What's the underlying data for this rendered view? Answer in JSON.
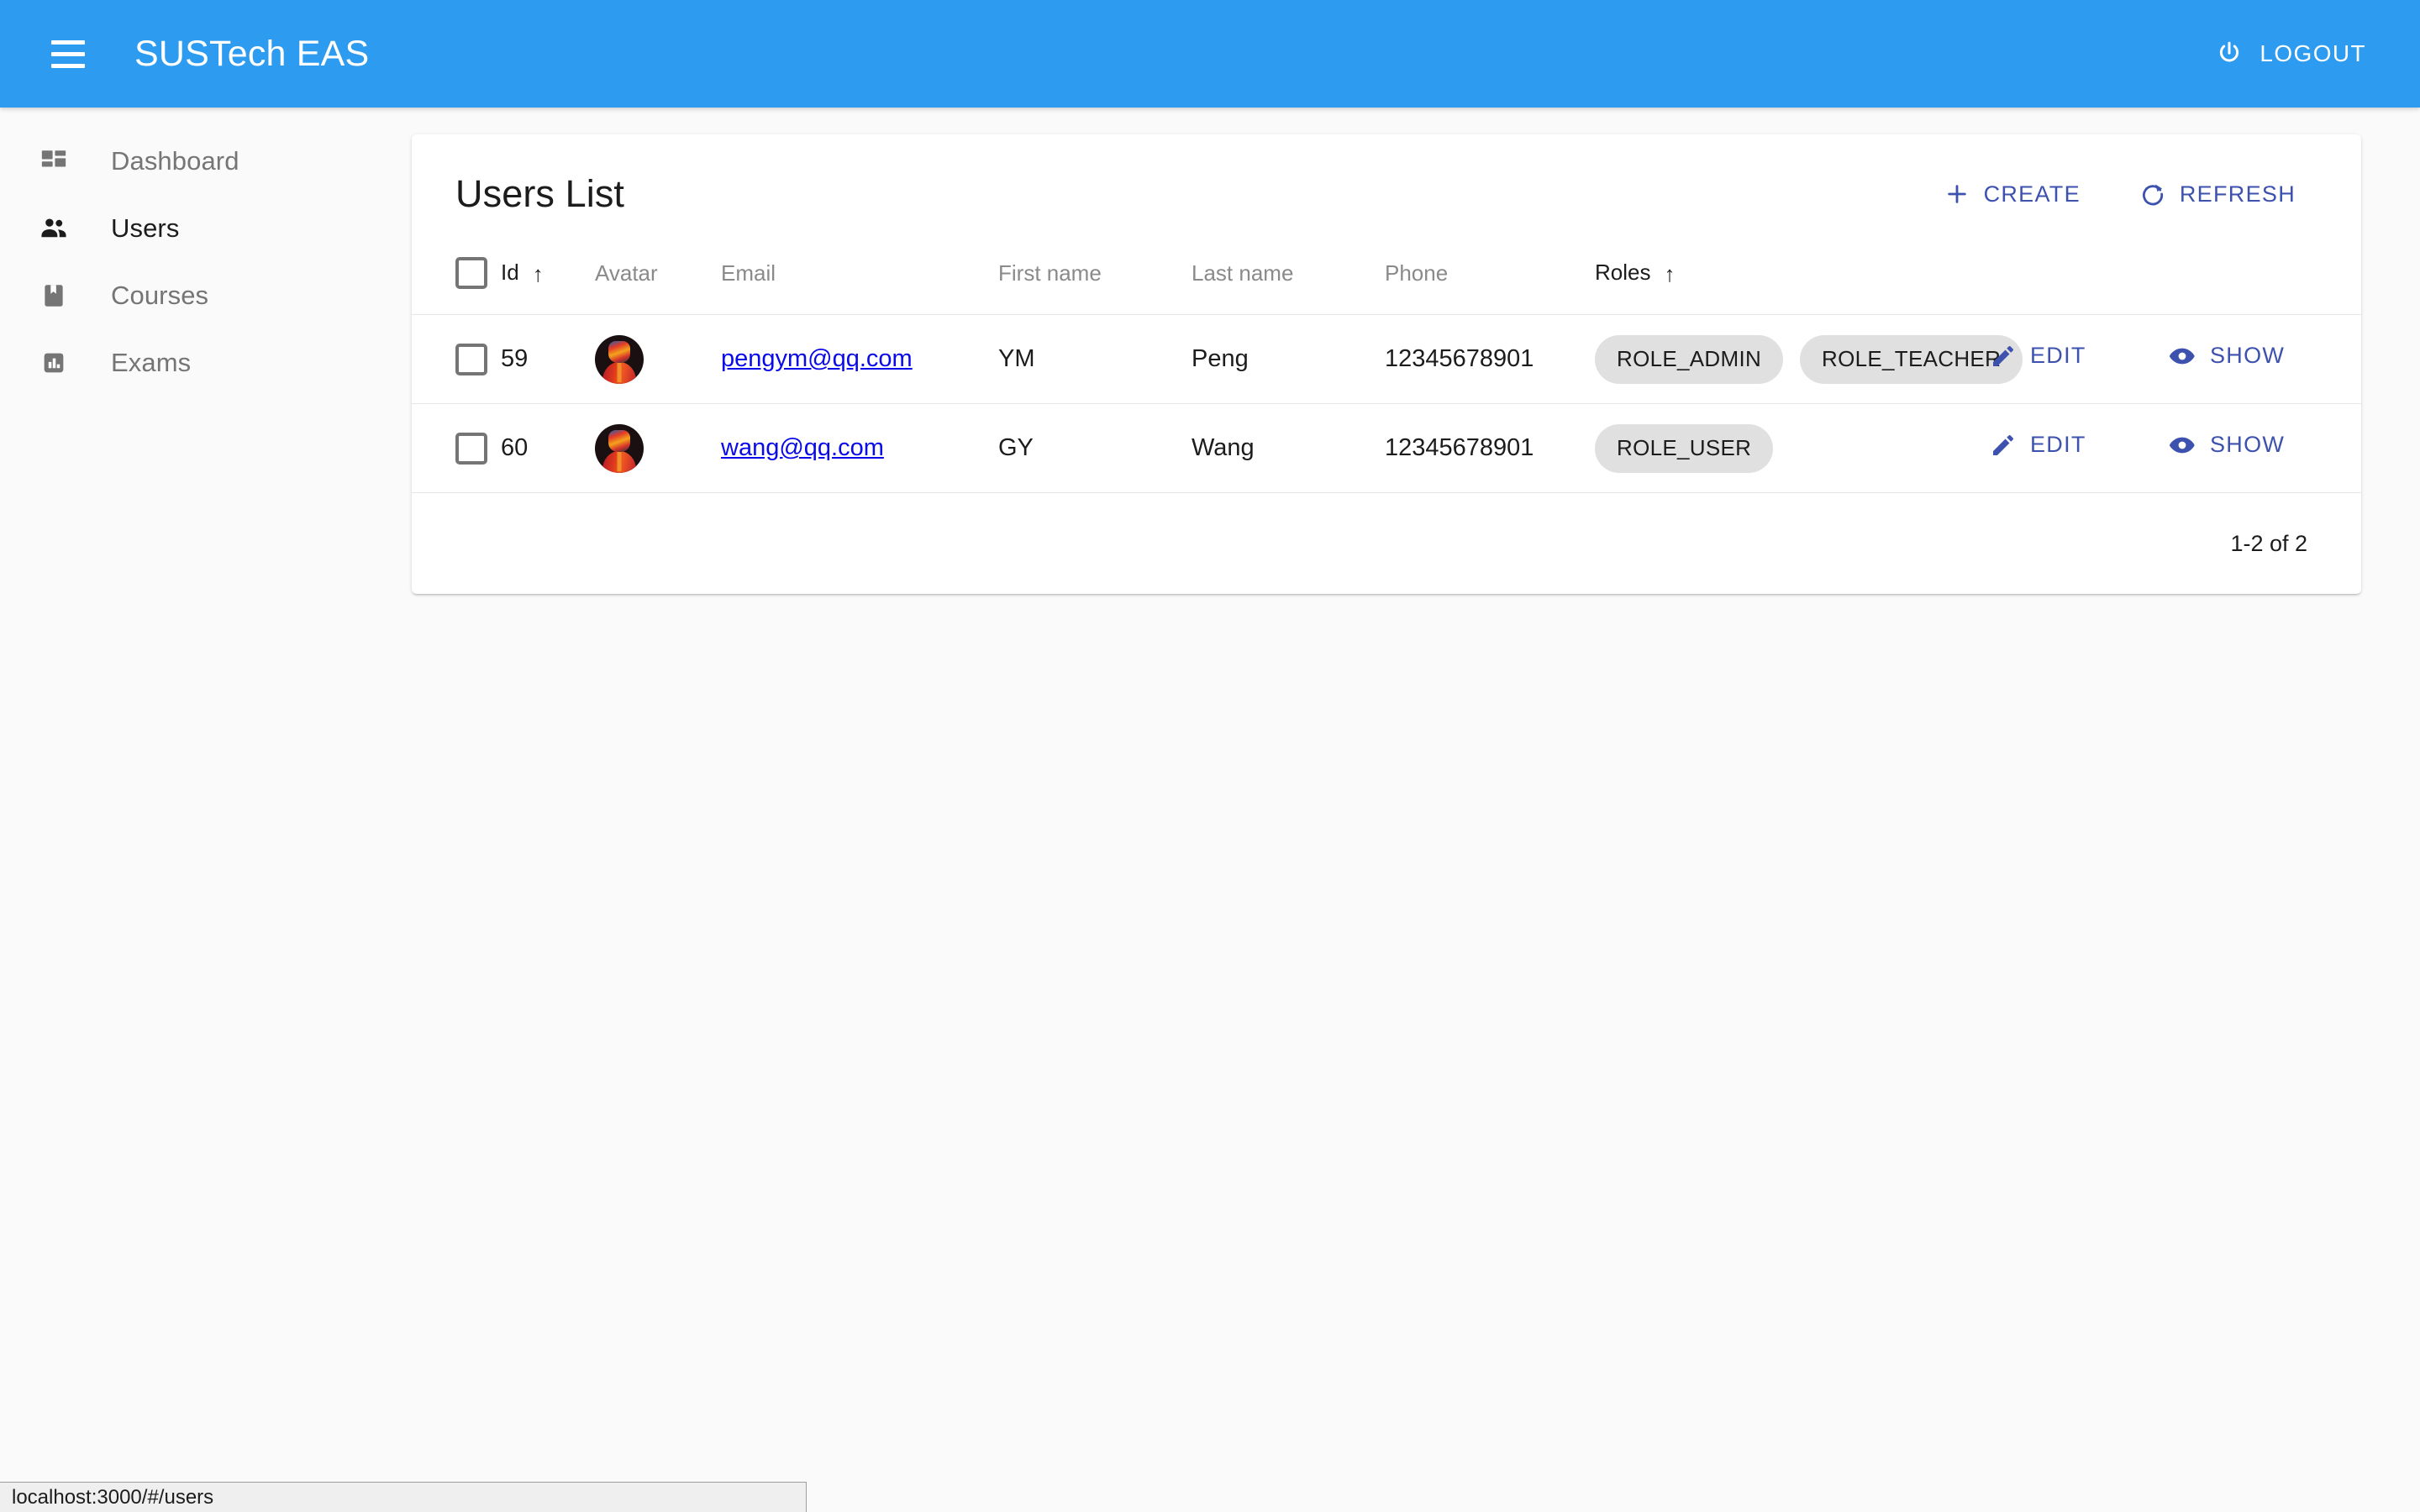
{
  "appbar": {
    "title": "SUSTech EAS",
    "menu_icon": "hamburger-menu-icon",
    "logout_label": "LOGOUT",
    "logout_icon": "power-icon",
    "background_color": "#2d9cf0",
    "text_color": "#ffffff"
  },
  "sidebar": {
    "items": [
      {
        "label": "Dashboard",
        "icon": "dashboard-icon",
        "active": false
      },
      {
        "label": "Users",
        "icon": "people-icon",
        "active": true
      },
      {
        "label": "Courses",
        "icon": "book-icon",
        "active": false
      },
      {
        "label": "Exams",
        "icon": "bar-chart-icon",
        "active": false
      }
    ]
  },
  "card": {
    "title": "Users List",
    "actions": {
      "create_label": "CREATE",
      "create_icon": "plus-icon",
      "refresh_label": "REFRESH",
      "refresh_icon": "refresh-icon",
      "accent_color": "#3d51ae"
    }
  },
  "table": {
    "columns": [
      {
        "key": "select",
        "label": "",
        "sorted": false
      },
      {
        "key": "id",
        "label": "Id",
        "sorted": true,
        "sort_dir": "asc"
      },
      {
        "key": "avatar",
        "label": "Avatar",
        "sorted": false
      },
      {
        "key": "email",
        "label": "Email",
        "sorted": false
      },
      {
        "key": "first_name",
        "label": "First name",
        "sorted": false
      },
      {
        "key": "last_name",
        "label": "Last name",
        "sorted": false
      },
      {
        "key": "phone",
        "label": "Phone",
        "sorted": false
      },
      {
        "key": "roles",
        "label": "Roles",
        "sorted": true,
        "sort_dir": "asc"
      }
    ],
    "sort_arrow_glyph": "↑",
    "rows": [
      {
        "id": "59",
        "avatar_alt": "user-avatar",
        "email": "pengym@qq.com",
        "first_name": "YM",
        "last_name": "Peng",
        "phone": "12345678901",
        "roles": [
          "ROLE_ADMIN",
          "ROLE_TEACHER"
        ],
        "edit_label": "EDIT",
        "show_label": "SHOW",
        "selected": false
      },
      {
        "id": "60",
        "avatar_alt": "user-avatar",
        "email": "wang@qq.com",
        "first_name": "GY",
        "last_name": "Wang",
        "phone": "12345678901",
        "roles": [
          "ROLE_USER"
        ],
        "edit_label": "EDIT",
        "show_label": "SHOW",
        "selected": false
      }
    ],
    "row_actions": {
      "edit_icon": "pencil-icon",
      "show_icon": "eye-icon"
    }
  },
  "paginator": {
    "range_label": "1-2 of 2"
  },
  "status_bar": {
    "url": "localhost:3000/#/users"
  }
}
